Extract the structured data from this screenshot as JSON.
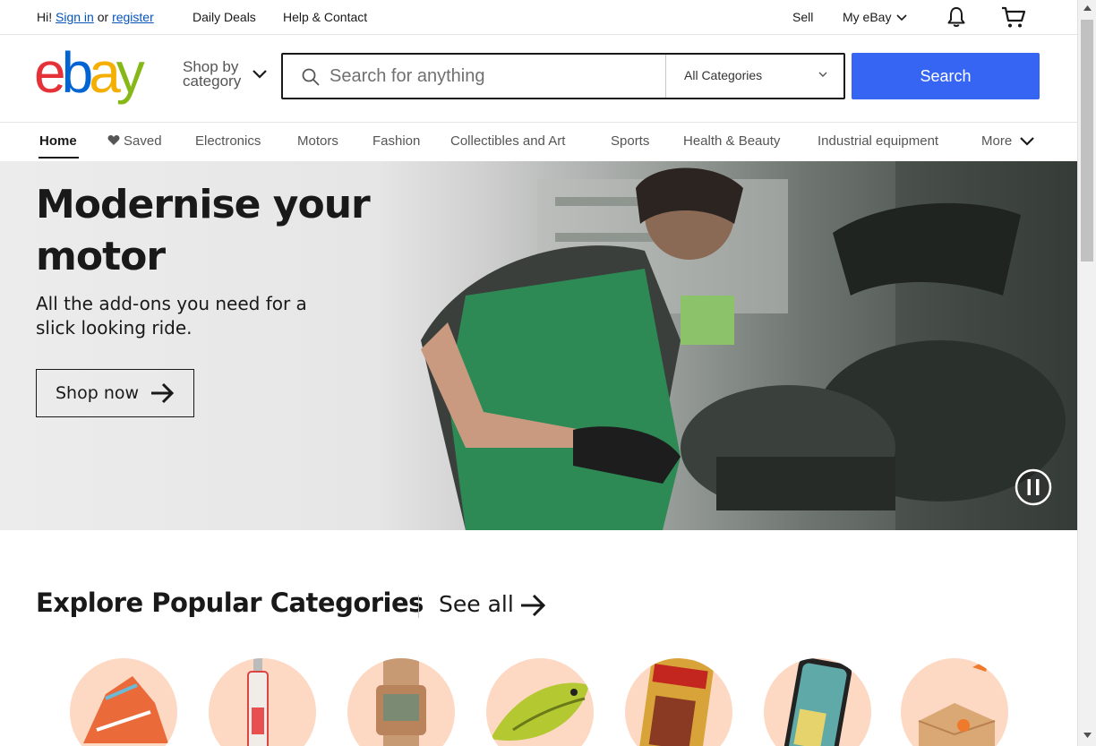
{
  "topbar": {
    "greeting_prefix": "Hi!",
    "sign_in": "Sign in",
    "or": "or",
    "register": "register",
    "daily_deals": "Daily Deals",
    "help_contact": "Help & Contact",
    "sell": "Sell",
    "my_ebay": "My eBay"
  },
  "header": {
    "logo": {
      "e": "e",
      "b": "b",
      "a": "a",
      "y": "y"
    },
    "shop_by_line1": "Shop by",
    "shop_by_line2": "category",
    "search_placeholder": "Search for anything",
    "category_select": "All Categories",
    "search_button": "Search"
  },
  "nav": {
    "items": [
      "Home",
      "Saved",
      "Electronics",
      "Motors",
      "Fashion",
      "Collectibles and Art",
      "Sports",
      "Health & Beauty",
      "Industrial equipment",
      "More"
    ]
  },
  "hero": {
    "title": "Modernise your motor",
    "subtitle": "All the add-ons you need for a slick looking ride.",
    "cta": "Shop now"
  },
  "explore": {
    "title": "Explore Popular Categories",
    "see_all": "See all"
  },
  "colors": {
    "brand_blue": "#3665f3",
    "link_blue": "#0654ba",
    "category_circle": "#fdd8c3"
  }
}
